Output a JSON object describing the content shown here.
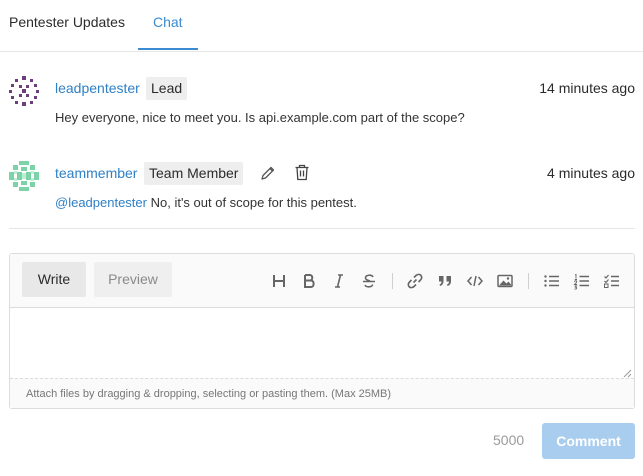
{
  "tabs": [
    {
      "label": "Pentester Updates",
      "active": false
    },
    {
      "label": "Chat",
      "active": true
    }
  ],
  "messages": [
    {
      "user": "leadpentester",
      "role": "Lead",
      "time": "14 minutes ago",
      "text": "Hey everyone, nice to meet you. Is api.example.com part of the scope?",
      "avatar_icon": "identicon-purple"
    },
    {
      "user": "teammember",
      "role": "Team Member",
      "time": "4 minutes ago",
      "mention": "@leadpentester",
      "text": " No, it's out of scope for this pentest.",
      "avatar_icon": "identicon-green",
      "actions": [
        "pencil-icon",
        "trash-icon"
      ]
    }
  ],
  "editor": {
    "write_tab": "Write",
    "preview_tab": "Preview",
    "toolbar_icons": [
      "heading-icon",
      "bold-icon",
      "italic-icon",
      "strikethrough-icon",
      "link-icon",
      "quote-icon",
      "code-icon",
      "image-icon",
      "bullet-list-icon",
      "numbered-list-icon",
      "task-list-icon"
    ],
    "value": "",
    "attach_hint": "Attach files by dragging & dropping, selecting or pasting them. (Max 25MB)"
  },
  "footer": {
    "remaining": "5000",
    "submit_label": "Comment"
  },
  "colors": {
    "accent": "#3a8bd0",
    "link": "#2f80c6",
    "button_disabled": "#a8cdee"
  }
}
